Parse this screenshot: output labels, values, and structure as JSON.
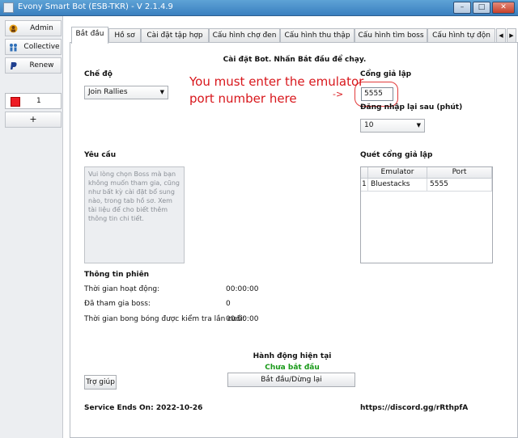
{
  "window": {
    "title": "Evony Smart Bot (ESB-TKR) - V 2.1.4.9",
    "minimize": "–",
    "maximize": "□",
    "close": "✕"
  },
  "sidebar": {
    "admin": "Admin",
    "collective": "Collective",
    "renew": "Renew",
    "tab_number": "1",
    "add": "+"
  },
  "tabs": [
    "Bắt đầu",
    "Hồ sơ",
    "Cài đặt tập hợp",
    "Cấu hình chợ đen",
    "Cấu hình thu thập",
    "Cấu hình tìm boss",
    "Cấu hình tự độn"
  ],
  "main": {
    "heading": "Cài đặt Bot. Nhấn Bắt đầu để chạy.",
    "mode_label": "Chế độ",
    "mode_value": "Join Rallies",
    "emulator_port_label": "Cổng giả lập",
    "emulator_port_value": "5555",
    "relogin_label": "Đăng nhập lại sau (phút)",
    "relogin_value": "10",
    "request_label": "Yêu cầu",
    "request_placeholder": "Vui lòng chọn Boss mà bạn không muốn tham gia, cũng như bất kỳ cài đặt bổ sung nào, trong tab hồ sơ. Xem tài liệu để cho biết thêm thông tin chi tiết.",
    "scan_label": "Quét cổng giả lập",
    "scan_table": {
      "columns": [
        "Emulator",
        "Port"
      ],
      "rows": [
        {
          "index": "1",
          "emulator": "Bluestacks",
          "port": "5555"
        }
      ]
    },
    "session_label": "Thông tin phiên",
    "session_rows": [
      {
        "label": "Thời gian hoạt động:",
        "value": "00:00:00"
      },
      {
        "label": "Đã tham gia boss:",
        "value": "0"
      },
      {
        "label": "Thời gian bong bóng được kiểm tra lần cuối:",
        "value": "00:00:00"
      }
    ],
    "current_action_label": "Hành động hiện tại",
    "current_action_status": "Chưa bắt đầu",
    "start_stop": "Bắt đầu/Dừng lại",
    "help": "Trợ giúp",
    "service_ends": "Service Ends On: 2022-10-26",
    "discord": "https://discord.gg/rRthpfA"
  },
  "annotation": {
    "line1": "You must enter the emulator",
    "line2": "port number here",
    "arrow": "->"
  },
  "colors": {
    "annotation": "#d8161b",
    "status_green": "#1a9a1a",
    "tab_swatch": "#ee1c24"
  }
}
